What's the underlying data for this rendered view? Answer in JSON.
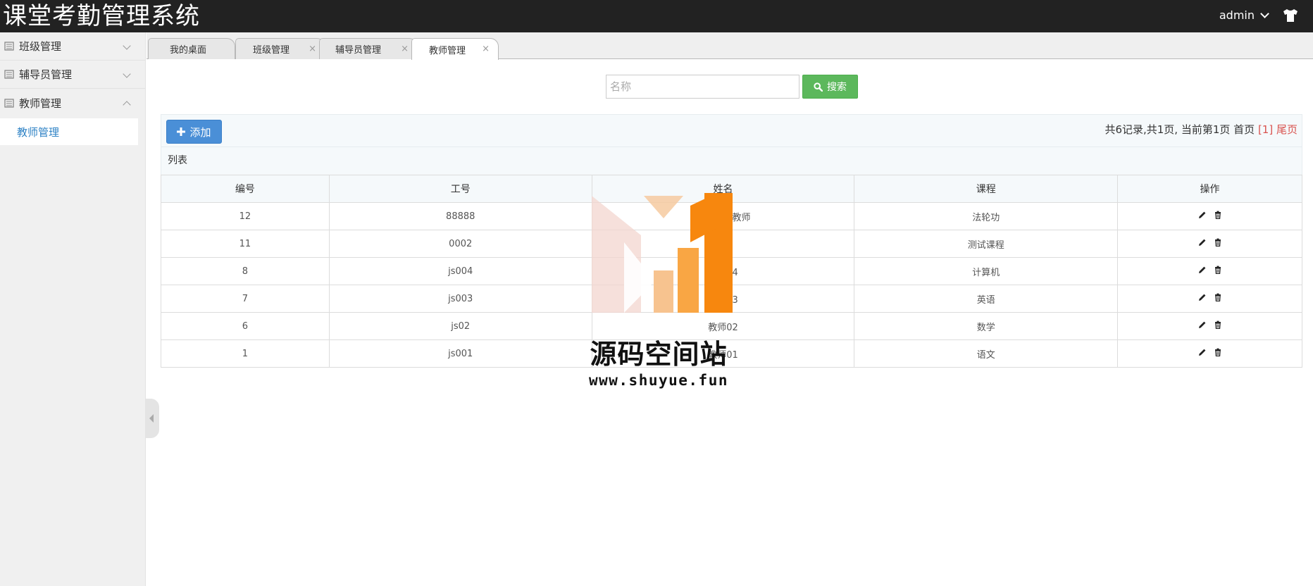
{
  "header": {
    "title": "课堂考勤管理系统",
    "user": "admin",
    "theme_icon": "tshirt-icon"
  },
  "sidebar": {
    "groups": [
      {
        "label": "班级管理",
        "expanded": false
      },
      {
        "label": "辅导员管理",
        "expanded": false
      },
      {
        "label": "教师管理",
        "expanded": true,
        "items": [
          {
            "label": "教师管理"
          }
        ]
      }
    ]
  },
  "tabs": [
    {
      "label": "我的桌面",
      "closable": false
    },
    {
      "label": "班级管理",
      "closable": true
    },
    {
      "label": "辅导员管理",
      "closable": true
    },
    {
      "label": "教师管理",
      "closable": true,
      "active": true
    }
  ],
  "search": {
    "placeholder": "名称",
    "value": "",
    "button_label": "搜索"
  },
  "toolbar": {
    "add_label": "添加",
    "pager": {
      "summary": "共6记录,共1页, 当前第1页",
      "first": "首页",
      "current": "[1]",
      "last": "尾页"
    }
  },
  "list": {
    "caption": "列表",
    "columns": [
      "编号",
      "工号",
      "姓名",
      "课程",
      "操作"
    ],
    "rows": [
      {
        "id": "12",
        "work_no": "88888",
        "name": "我是测试教师",
        "course": "法轮功"
      },
      {
        "id": "11",
        "work_no": "0002",
        "name": "教师",
        "course": "测试课程"
      },
      {
        "id": "8",
        "work_no": "js004",
        "name": "教师04",
        "course": "计算机"
      },
      {
        "id": "7",
        "work_no": "js003",
        "name": "教师03",
        "course": "英语"
      },
      {
        "id": "6",
        "work_no": "js02",
        "name": "教师02",
        "course": "数学"
      },
      {
        "id": "1",
        "work_no": "js001",
        "name": "教师01",
        "course": "语文"
      }
    ]
  },
  "watermark": {
    "text": "源码空间站",
    "url": "www.shuyue.fun"
  },
  "colors": {
    "header_bg": "#222222",
    "search_btn": "#5cb85c",
    "add_btn": "#4a8fd7",
    "active_link": "#2e82c5",
    "pager_red": "#d9534f",
    "watermark_orange": "#f7941d"
  }
}
